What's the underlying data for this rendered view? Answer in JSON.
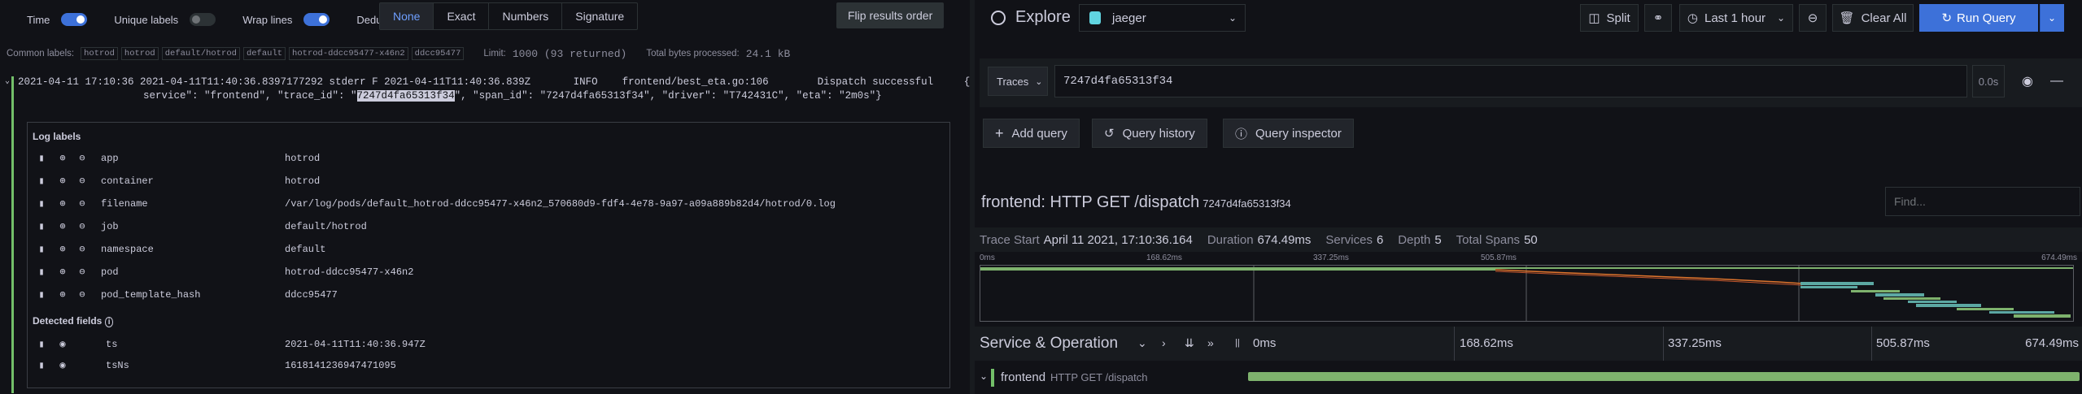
{
  "logs": {
    "options": [
      {
        "label": "Time",
        "on": true
      },
      {
        "label": "Unique labels",
        "on": false
      },
      {
        "label": "Wrap lines",
        "on": true
      },
      {
        "label": "Dedup",
        "on": true
      }
    ],
    "dedup_modes": [
      "None",
      "Exact",
      "Numbers",
      "Signature"
    ],
    "dedup_active": "None",
    "flip_label": "Flip results order",
    "common_labels_title": "Common labels:",
    "common_labels": [
      "hotrod",
      "hotrod",
      "default/hotrod",
      "default",
      "hotrod-ddcc95477-x46n2",
      "ddcc95477"
    ],
    "limit_label": "Limit:",
    "limit_value": "1000 (93 returned)",
    "bytes_label": "Total bytes processed:",
    "bytes_value": "24.1 kB",
    "row": {
      "line1": "2021-04-11 17:10:36 2021-04-11T11:40:36.8397177292 stderr F 2021-04-11T11:40:36.839Z       INFO    frontend/best_eta.go:106        Dispatch successful     {\"",
      "line2_pre": "service\": \"frontend\", \"trace_id\": \"",
      "line2_hl": "7247d4fa65313f34",
      "line2_post": "\", \"span_id\": \"7247d4fa65313f34\", \"driver\": \"T742431C\", \"eta\": \"2m0s\"}"
    },
    "details_title": "Log labels",
    "labels": [
      {
        "key": "app",
        "value": "hotrod"
      },
      {
        "key": "container",
        "value": "hotrod"
      },
      {
        "key": "filename",
        "value": "/var/log/pods/default_hotrod-ddcc95477-x46n2_570680d9-fdf4-4e78-9a97-a09a889b82d4/hotrod/0.log"
      },
      {
        "key": "job",
        "value": "default/hotrod"
      },
      {
        "key": "namespace",
        "value": "default"
      },
      {
        "key": "pod",
        "value": "hotrod-ddcc95477-x46n2"
      },
      {
        "key": "pod_template_hash",
        "value": "ddcc95477"
      }
    ],
    "detected_title": "Detected fields",
    "fields": [
      {
        "key": "ts",
        "value": "2021-04-11T11:40:36.947Z"
      },
      {
        "key": "tsNs",
        "value": "1618141236947471095"
      }
    ]
  },
  "explore": {
    "title": "Explore",
    "datasource": "jaeger",
    "split_label": "Split",
    "time_label": "Last 1 hour",
    "clear_label": "Clear All",
    "run_label": "Run Query",
    "query_type": "Traces",
    "query_value": "7247d4fa65313f34",
    "query_duration": "0.0s",
    "add_query": "Add query",
    "query_history": "Query history",
    "query_inspector": "Query inspector"
  },
  "trace": {
    "title": "frontend: HTTP GET /dispatch",
    "trace_id": "7247d4fa65313f34",
    "find_placeholder": "Find...",
    "meta": [
      {
        "label": "Trace Start",
        "value": "April 11 2021, 17:10:36.164"
      },
      {
        "label": "Duration",
        "value": "674.49ms"
      },
      {
        "label": "Services",
        "value": "6"
      },
      {
        "label": "Depth",
        "value": "5"
      },
      {
        "label": "Total Spans",
        "value": "50"
      }
    ],
    "ticks": [
      "0ms",
      "168.62ms",
      "337.25ms",
      "505.87ms",
      "674.49ms"
    ],
    "header_title": "Service & Operation",
    "root_service": "frontend",
    "root_operation": "HTTP GET /dispatch"
  },
  "colors": {
    "accent": "#3d71d9",
    "span_green": "#7eb26d",
    "span_teal": "#5ca8a3",
    "span_red": "#e0752d"
  }
}
